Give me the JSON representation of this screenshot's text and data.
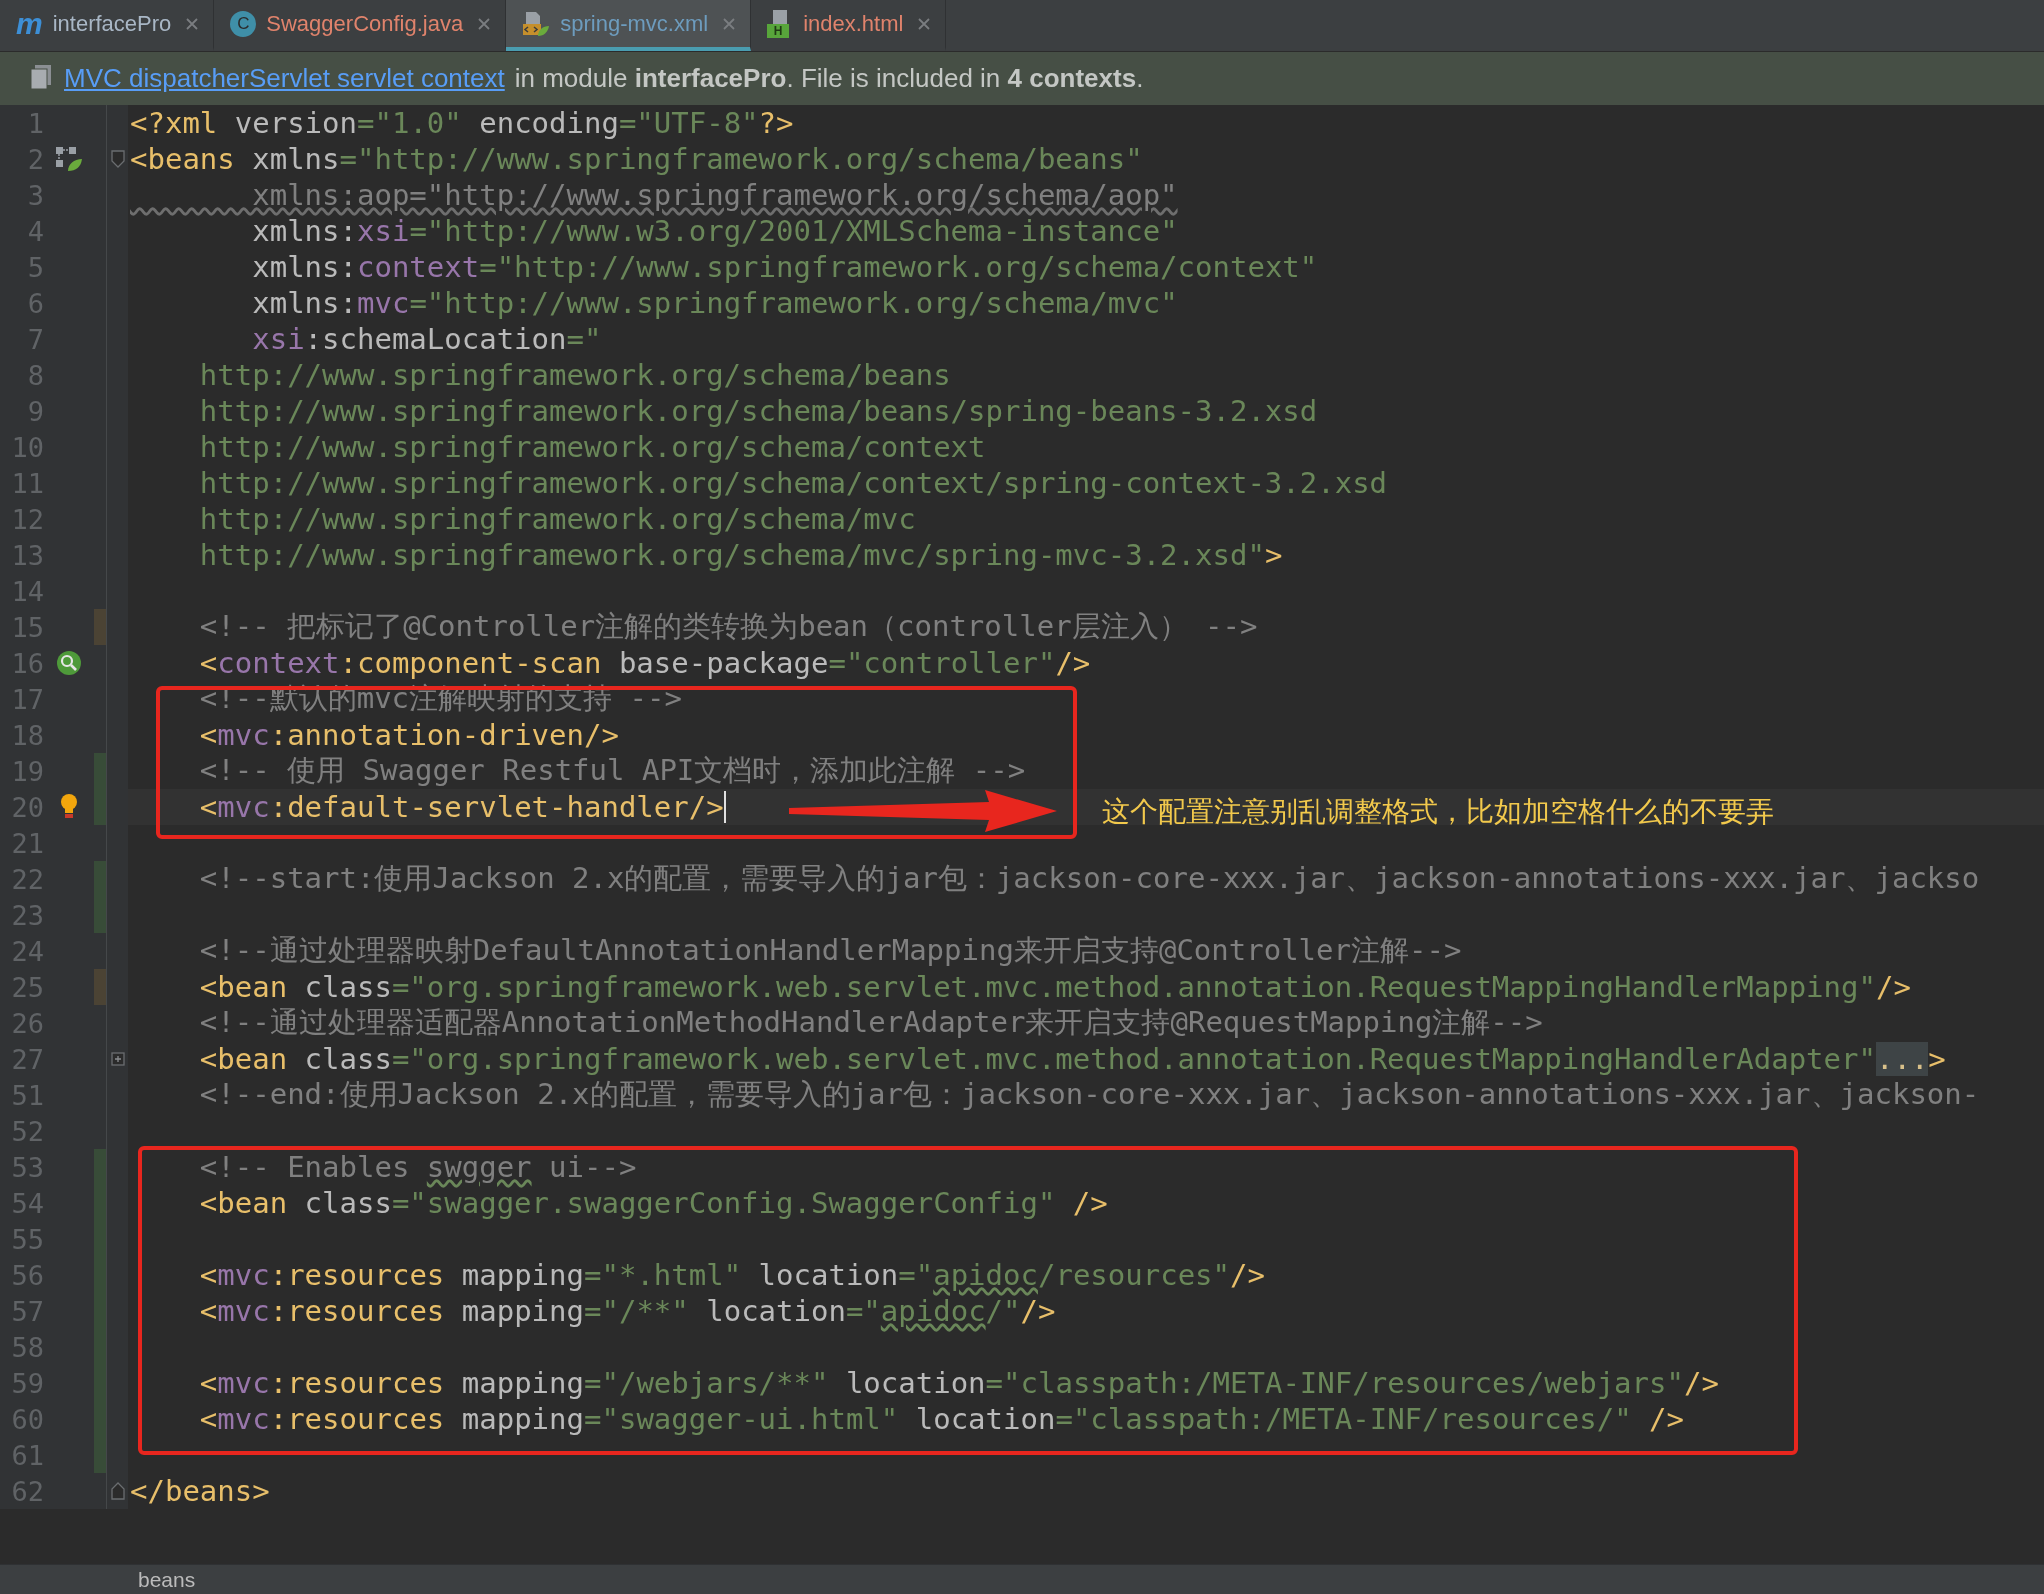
{
  "tabs": [
    {
      "label": "interfacePro",
      "icon_letter": "m",
      "color": "#a9b7c6",
      "selected": false
    },
    {
      "label": "SwaggerConfig.java",
      "icon_letter": "C",
      "color": "#e0836c",
      "selected": false
    },
    {
      "label": "spring-mvc.xml",
      "color": "#6d9cbe",
      "selected": true
    },
    {
      "label": "index.html",
      "icon_letter": "H",
      "color": "#e0836c",
      "selected": false
    }
  ],
  "context_bar": {
    "link": "MVC dispatcherServlet servlet context",
    "text": "in module **interfacePro**. File is included in **4 contexts**."
  },
  "lines": [
    {
      "number": "1",
      "current": false,
      "tokens": [
        {
          "text": "<?xml",
          "kind": "tag"
        },
        {
          "text": " version",
          "kind": "attr"
        },
        {
          "text": "=\"1.0\"",
          "kind": "value"
        },
        {
          "text": " encoding",
          "kind": "attr"
        },
        {
          "text": "=\"UTF-8\"",
          "kind": "value"
        },
        {
          "text": "?>",
          "kind": "tag"
        }
      ]
    },
    {
      "number": "2",
      "current": false,
      "tokens": [
        {
          "text": "<beans",
          "kind": "tag"
        },
        {
          "text": " xmlns",
          "kind": "attr"
        },
        {
          "text": "=\"http://www.springframework.org/schema/beans\"",
          "kind": "value"
        }
      ]
    },
    {
      "number": "3",
      "current": false,
      "tokens": [
        {
          "text": "       xmlns:aop=\"http://www.springframework.org/schema/aop\"",
          "kind": "unused"
        }
      ]
    },
    {
      "number": "4",
      "current": false,
      "tokens": [
        {
          "text": "       xmlns:",
          "kind": "attr"
        },
        {
          "text": "xsi",
          "kind": "ns"
        },
        {
          "text": "=\"http://www.w3.org/2001/XMLSchema-instance\"",
          "kind": "value"
        }
      ]
    },
    {
      "number": "5",
      "current": false,
      "tokens": [
        {
          "text": "       xmlns:",
          "kind": "attr"
        },
        {
          "text": "context",
          "kind": "ns"
        },
        {
          "text": "=\"http://www.springframework.org/schema/context\"",
          "kind": "value"
        }
      ]
    },
    {
      "number": "6",
      "current": false,
      "tokens": [
        {
          "text": "       xmlns:",
          "kind": "attr"
        },
        {
          "text": "mvc",
          "kind": "ns"
        },
        {
          "text": "=\"http://www.springframework.org/schema/mvc\"",
          "kind": "value"
        }
      ]
    },
    {
      "number": "7",
      "current": false,
      "tokens": [
        {
          "text": "       xsi",
          "kind": "ns"
        },
        {
          "text": ":schemaLocation",
          "kind": "attr"
        },
        {
          "text": "=\"",
          "kind": "value"
        }
      ]
    },
    {
      "number": "8",
      "current": false,
      "tokens": [
        {
          "text": "    http://www.springframework.org/schema/beans",
          "kind": "value"
        }
      ]
    },
    {
      "number": "9",
      "current": false,
      "tokens": [
        {
          "text": "    http://www.springframework.org/schema/beans/spring-beans-3.2.xsd",
          "kind": "value"
        }
      ]
    },
    {
      "number": "10",
      "current": false,
      "tokens": [
        {
          "text": "    http://www.springframework.org/schema/context",
          "kind": "value"
        }
      ]
    },
    {
      "number": "11",
      "current": false,
      "tokens": [
        {
          "text": "    http://www.springframework.org/schema/context/spring-context-3.2.xsd",
          "kind": "value"
        }
      ]
    },
    {
      "number": "12",
      "current": false,
      "tokens": [
        {
          "text": "    http://www.springframework.org/schema/mvc",
          "kind": "value"
        }
      ]
    },
    {
      "number": "13",
      "current": false,
      "tokens": [
        {
          "text": "    http://www.springframework.org/schema/mvc/spring-mvc-3.2.xsd\"",
          "kind": "value"
        },
        {
          "text": ">",
          "kind": "tag"
        }
      ]
    },
    {
      "number": "14",
      "current": false
    },
    {
      "number": "15",
      "current": false,
      "marker": {
        "color": "#4b4334"
      },
      "tokens": [
        {
          "text": "    <!-- 把标记了@Controller注解的类转换为bean（controller层注入） -->",
          "kind": "comment"
        }
      ]
    },
    {
      "number": "16",
      "current": false,
      "tokens": [
        {
          "text": "    <",
          "kind": "tag"
        },
        {
          "text": "context",
          "kind": "ns"
        },
        {
          "text": ":component-scan",
          "kind": "tag"
        },
        {
          "text": " base-package",
          "kind": "attr"
        },
        {
          "text": "=\"controller\"",
          "kind": "value"
        },
        {
          "text": "/>",
          "kind": "tag"
        }
      ]
    },
    {
      "number": "17",
      "current": false,
      "tokens": [
        {
          "text": "    <!--默认的mvc注解映射的支持 -->",
          "kind": "comment"
        }
      ]
    },
    {
      "number": "18",
      "current": false,
      "tokens": [
        {
          "text": "    <",
          "kind": "tag"
        },
        {
          "text": "mvc",
          "kind": "ns"
        },
        {
          "text": ":annotation-driven/>",
          "kind": "tag"
        }
      ]
    },
    {
      "number": "19",
      "current": false,
      "marker": {
        "color": "#384c38"
      },
      "tokens": [
        {
          "text": "    <!-- 使用 Swagger Restful API文档时，添加此注解 -->",
          "kind": "comment"
        }
      ]
    },
    {
      "number": "20",
      "current": true,
      "marker": {
        "color": "#384c38"
      },
      "tokens": [
        {
          "text": "    <",
          "kind": "tag"
        },
        {
          "text": "mvc",
          "kind": "ns"
        },
        {
          "text": ":default-servlet-handler",
          "kind": "tag"
        },
        {
          "text": "/>",
          "kind": "tag"
        }
      ]
    },
    {
      "number": "21",
      "current": false
    },
    {
      "number": "22",
      "current": false,
      "marker": {
        "color": "#384c38"
      },
      "tokens": [
        {
          "text": "    <!--start:使用Jackson 2.x的配置，需要导入的jar包：jackson-core-xxx.jar、jackson-annotations-xxx.jar、jackso",
          "kind": "comment"
        }
      ]
    },
    {
      "number": "23",
      "current": false,
      "marker": {
        "color": "#384c38"
      }
    },
    {
      "number": "24",
      "current": false,
      "tokens": [
        {
          "text": "    <!--通过处理器映射DefaultAnnotationHandlerMapping来开启支持@Controller注解-->",
          "kind": "comment"
        }
      ]
    },
    {
      "number": "25",
      "current": false,
      "marker": {
        "color": "#4b4334"
      },
      "tokens": [
        {
          "text": "    <bean",
          "kind": "tag"
        },
        {
          "text": " class",
          "kind": "attr"
        },
        {
          "text": "=\"org.springframework.web.servlet.mvc.method.annotation.RequestMappingHandlerMapping\"",
          "kind": "value"
        },
        {
          "text": "/>",
          "kind": "tag"
        }
      ]
    },
    {
      "number": "26",
      "current": false,
      "tokens": [
        {
          "text": "    <!--通过处理器适配器AnnotationMethodHandlerAdapter来开启支持@RequestMapping注解-->",
          "kind": "comment"
        }
      ]
    },
    {
      "number": "27",
      "current": false,
      "tokens": [
        {
          "text": "    <bean",
          "kind": "tag"
        },
        {
          "text": " class",
          "kind": "attr"
        },
        {
          "text": "=\"org.springframework.web.servlet.mvc.method.annotation.RequestMappingHandlerAdapter\"",
          "kind": "value"
        },
        {
          "text": "...",
          "kind": "fold"
        },
        {
          "text": ">",
          "kind": "tag"
        }
      ]
    },
    {
      "number": "51",
      "current": false,
      "tokens": [
        {
          "text": "    <!--end:使用Jackson 2.x的配置，需要导入的jar包：jackson-core-xxx.jar、jackson-annotations-xxx.jar、jackson-",
          "kind": "comment"
        }
      ]
    },
    {
      "number": "52",
      "current": false
    },
    {
      "number": "53",
      "current": false,
      "marker": {
        "color": "#384c38"
      },
      "tokens": [
        {
          "text": "    <!-- Enables ",
          "kind": "comment"
        },
        {
          "text": "swgger",
          "kind": "comment-typo"
        },
        {
          "text": " ui-->",
          "kind": "comment"
        }
      ]
    },
    {
      "number": "54",
      "current": false,
      "marker": {
        "color": "#384c38"
      },
      "tokens": [
        {
          "text": "    <bean",
          "kind": "tag"
        },
        {
          "text": " class",
          "kind": "attr"
        },
        {
          "text": "=\"swagger.swaggerConfig.SwaggerConfig\"",
          "kind": "value"
        },
        {
          "text": " />",
          "kind": "tag"
        }
      ]
    },
    {
      "number": "55",
      "current": false,
      "marker": {
        "color": "#384c38"
      }
    },
    {
      "number": "56",
      "current": false,
      "marker": {
        "color": "#384c38"
      },
      "tokens": [
        {
          "text": "    <",
          "kind": "tag"
        },
        {
          "text": "mvc",
          "kind": "ns"
        },
        {
          "text": ":resources",
          "kind": "tag"
        },
        {
          "text": " mapping",
          "kind": "attr"
        },
        {
          "text": "=\"*.html\"",
          "kind": "value"
        },
        {
          "text": " location",
          "kind": "attr"
        },
        {
          "text": "=\"",
          "kind": "value"
        },
        {
          "text": "apidoc",
          "kind": "value-typo"
        },
        {
          "text": "/resources\"",
          "kind": "value"
        },
        {
          "text": "/>",
          "kind": "tag"
        }
      ]
    },
    {
      "number": "57",
      "current": false,
      "marker": {
        "color": "#384c38"
      },
      "tokens": [
        {
          "text": "    <",
          "kind": "tag"
        },
        {
          "text": "mvc",
          "kind": "ns"
        },
        {
          "text": ":resources",
          "kind": "tag"
        },
        {
          "text": " mapping",
          "kind": "attr"
        },
        {
          "text": "=\"/**\"",
          "kind": "value"
        },
        {
          "text": " location",
          "kind": "attr"
        },
        {
          "text": "=\"",
          "kind": "value"
        },
        {
          "text": "apidoc",
          "kind": "value-typo"
        },
        {
          "text": "/\"",
          "kind": "value"
        },
        {
          "text": "/>",
          "kind": "tag"
        }
      ]
    },
    {
      "number": "58",
      "current": false,
      "marker": {
        "color": "#384c38"
      }
    },
    {
      "number": "59",
      "current": false,
      "marker": {
        "color": "#384c38"
      },
      "tokens": [
        {
          "text": "    <",
          "kind": "tag"
        },
        {
          "text": "mvc",
          "kind": "ns"
        },
        {
          "text": ":resources",
          "kind": "tag"
        },
        {
          "text": " mapping",
          "kind": "attr"
        },
        {
          "text": "=\"/webjars/**\"",
          "kind": "value"
        },
        {
          "text": " location",
          "kind": "attr"
        },
        {
          "text": "=\"classpath:/META-INF/resources/webjars\"",
          "kind": "value"
        },
        {
          "text": "/>",
          "kind": "tag"
        }
      ]
    },
    {
      "number": "60",
      "current": false,
      "marker": {
        "color": "#384c38"
      },
      "tokens": [
        {
          "text": "    <",
          "kind": "tag"
        },
        {
          "text": "mvc",
          "kind": "ns"
        },
        {
          "text": ":resources",
          "kind": "tag"
        },
        {
          "text": " mapping",
          "kind": "attr"
        },
        {
          "text": "=\"swagger-ui.html\"",
          "kind": "value"
        },
        {
          "text": " location",
          "kind": "attr"
        },
        {
          "text": "=\"classpath:/META-INF/resources/\"",
          "kind": "value"
        },
        {
          "text": " />",
          "kind": "tag"
        }
      ]
    },
    {
      "number": "61",
      "current": false,
      "marker": {
        "color": "#384c38"
      }
    },
    {
      "number": "62",
      "current": false,
      "tokens": [
        {
          "text": "</beans>",
          "kind": "tag"
        }
      ]
    }
  ],
  "annotation": {
    "note": "这个配置注意别乱调整格式，比如加空格什么的不要弄"
  },
  "status_bar": {
    "breadcrumb": "beans"
  }
}
